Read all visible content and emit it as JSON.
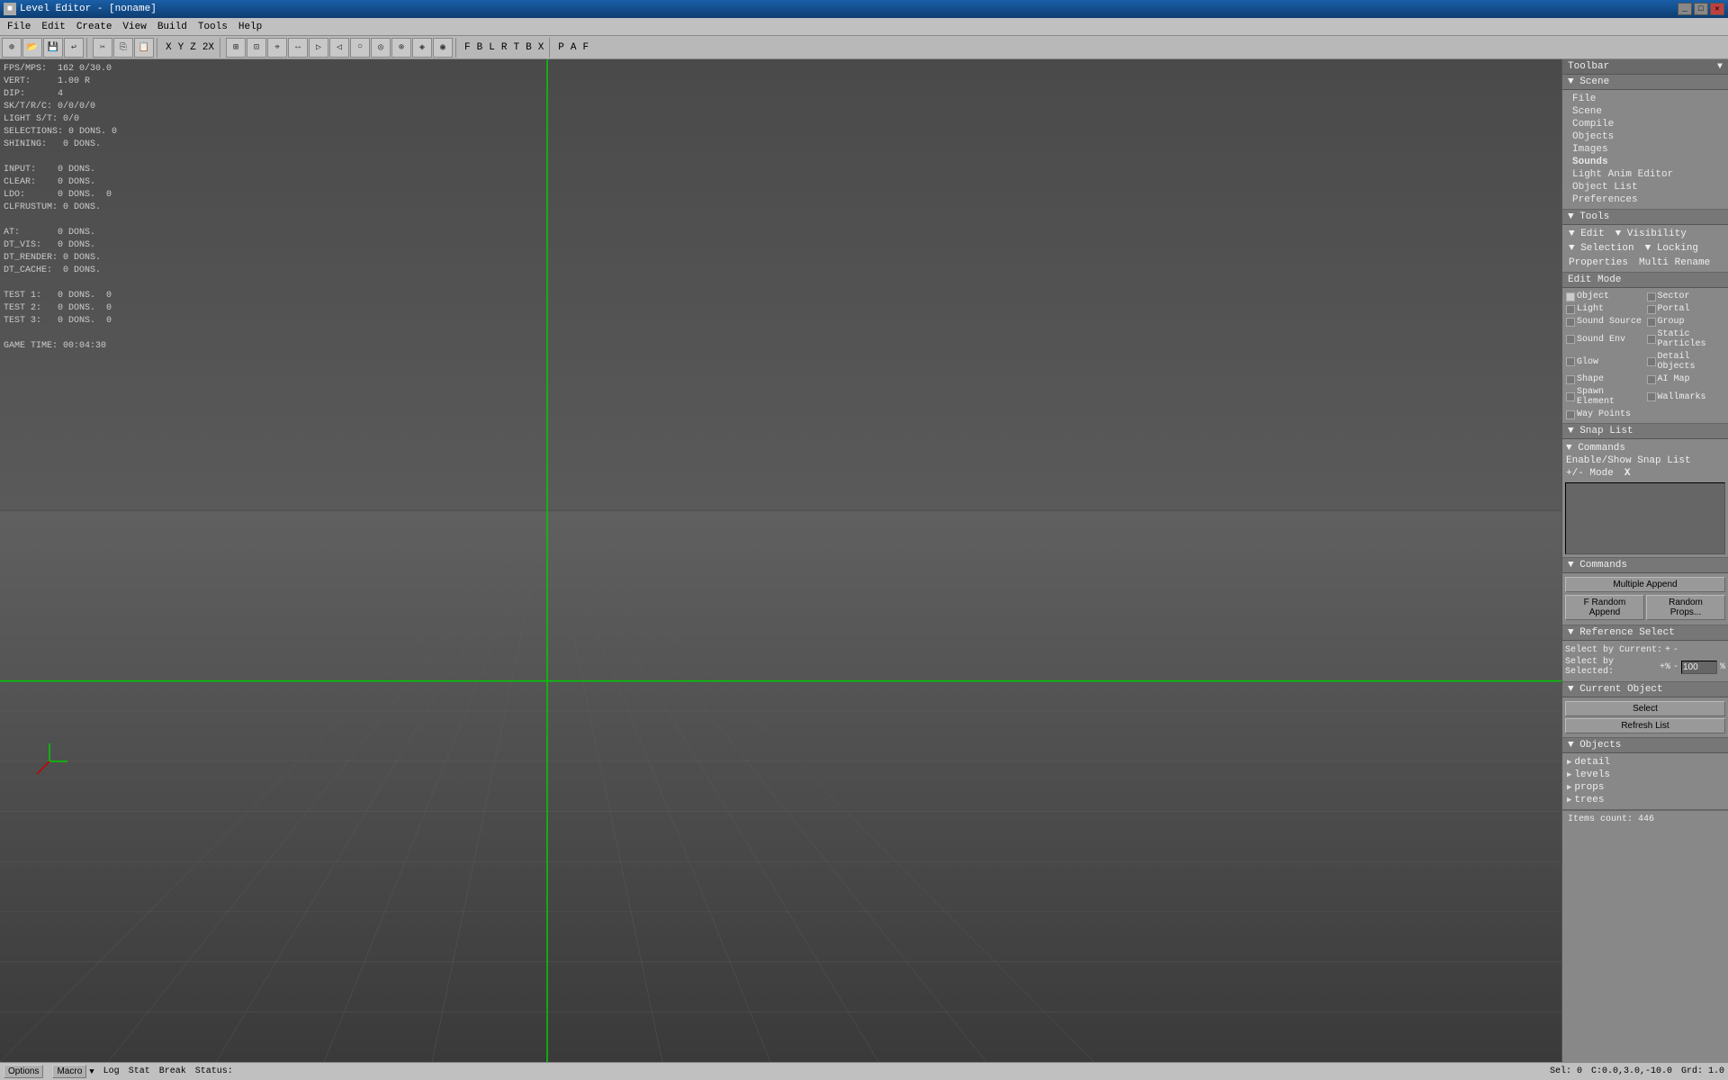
{
  "titleBar": {
    "title": "Level Editor - [noname]",
    "icon": "■",
    "winButtons": [
      "_",
      "□",
      "✕"
    ]
  },
  "menuBar": {
    "items": [
      "File",
      "Edit",
      "Create",
      "View",
      "Build",
      "Tools",
      "Help"
    ]
  },
  "toolbar": {
    "groups": [
      {
        "type": "buttons",
        "items": [
          "⊕",
          "↩",
          "↪",
          "💾",
          "📁"
        ]
      },
      {
        "type": "sep"
      },
      {
        "type": "buttons",
        "items": [
          "✂",
          "📋",
          "🗑"
        ]
      },
      {
        "type": "sep"
      },
      {
        "type": "labels",
        "items": [
          "X",
          "Y",
          "Z",
          "2X"
        ]
      },
      {
        "type": "sep"
      },
      {
        "type": "buttons",
        "items": [
          "⊞",
          "⊡",
          "⌖",
          "↔",
          "⊳",
          "⊲",
          "⊙",
          "⊘",
          "⊗",
          "◈",
          "◉"
        ]
      },
      {
        "type": "sep"
      },
      {
        "type": "labels",
        "items": [
          "F",
          "B",
          "L",
          "R",
          "T",
          "B",
          "X"
        ]
      },
      {
        "type": "sep"
      },
      {
        "type": "labels",
        "items": [
          "P",
          "A",
          "F"
        ]
      }
    ]
  },
  "debugInfo": {
    "lines": [
      "FPS/MPS:  162 0/30.0",
      "VERT:     1.00 R",
      "DIP:      4",
      "SK/T/R/C: 0/0/0/0",
      "LIGHT S/T: 0/0",
      "SELECTIONS: 0 DONS. 0",
      "SHINING:   0 DONS.",
      "",
      "INPUT:    0 DONS.",
      "CLEAR:    0 DONS.",
      "LDO:      0 DONS.  0",
      "CLFRUSTUM: 0 DONS.",
      "",
      "AT:       0 DONS.",
      "DT_VIS:   0 DONS.",
      "DT_RENDER: 0 DONS.",
      "DT_CACHE: 0 DONS.",
      "",
      "TEST 1:   0 DONS.  0",
      "TEST 2:   0 DONS.  0",
      "TEST 3:   0 DONS.  0",
      "",
      "GAME TIME: 00:04:30"
    ]
  },
  "rightPanel": {
    "toolbar": {
      "label": "Toolbar",
      "dropdownIcon": "▼"
    },
    "scene": {
      "header": "Scene",
      "items": [
        "File",
        "Scene",
        "Compile",
        "Objects",
        "Images",
        "Sounds",
        "Light Anim Editor",
        "Object List",
        "Preferences"
      ]
    },
    "tools": {
      "header": "Tools",
      "leftItems": [
        "Edit",
        "Selection",
        "Properties"
      ],
      "rightItems": [
        "Visibility",
        "Locking",
        "Multi Rename"
      ]
    },
    "editMode": {
      "header": "Edit Mode",
      "items": [
        {
          "label": "Object",
          "checked": true
        },
        {
          "label": "Sector",
          "checked": false
        },
        {
          "label": "Light",
          "checked": false
        },
        {
          "label": "Portal",
          "checked": false
        },
        {
          "label": "Sound Source",
          "checked": false
        },
        {
          "label": "Group",
          "checked": false
        },
        {
          "label": "Sound Env",
          "checked": false
        },
        {
          "label": "Static Particles",
          "checked": false
        },
        {
          "label": "Glow",
          "checked": false
        },
        {
          "label": "Detail Objects",
          "checked": false
        },
        {
          "label": "Shape",
          "checked": false
        },
        {
          "label": "AI Map",
          "checked": false
        },
        {
          "label": "Spawn Element",
          "checked": false
        },
        {
          "label": "Wallmarks",
          "checked": false
        },
        {
          "label": "Way Points",
          "checked": false
        }
      ]
    },
    "snapList": {
      "header": "Snap List",
      "commandsLabel": "Commands",
      "enableLabel": "Enable/Show Snap List",
      "modeLabel": "+/- Mode",
      "modeValue": "X"
    },
    "commands": {
      "header": "Commands",
      "multipleAppend": "Multiple Append",
      "randomAppend": "F Random Append",
      "randomProps": "Random Props..."
    },
    "referenceSelect": {
      "header": "Reference Select",
      "selectByCurrent": "Select by Current:",
      "selectBySelected": "Select by Selected:",
      "plusSign": "+",
      "separator": "-",
      "percentValue": "100",
      "percentSign": "%",
      "plusSignSel": "+%",
      "sepSel": "-",
      "valSel": "100",
      "percSel": "%"
    },
    "currentObject": {
      "header": "Current Object",
      "selectBtn": "Select",
      "refreshBtn": "Refresh List"
    },
    "objects": {
      "header": "Objects",
      "items": [
        "detail",
        "levels",
        "props",
        "trees"
      ]
    }
  },
  "statusBar": {
    "optionsLabel": "Options",
    "macroLabel": "Macro",
    "macroDropdown": "▼",
    "logLabel": "Log",
    "statLabel": "Stat",
    "breakLabel": "Break",
    "statusLabel": "Status:",
    "selInfo": "Sel: 0",
    "coordInfo": "C:0.0,3.0,-10.0",
    "gridInfo": "Grd: 1.0"
  }
}
